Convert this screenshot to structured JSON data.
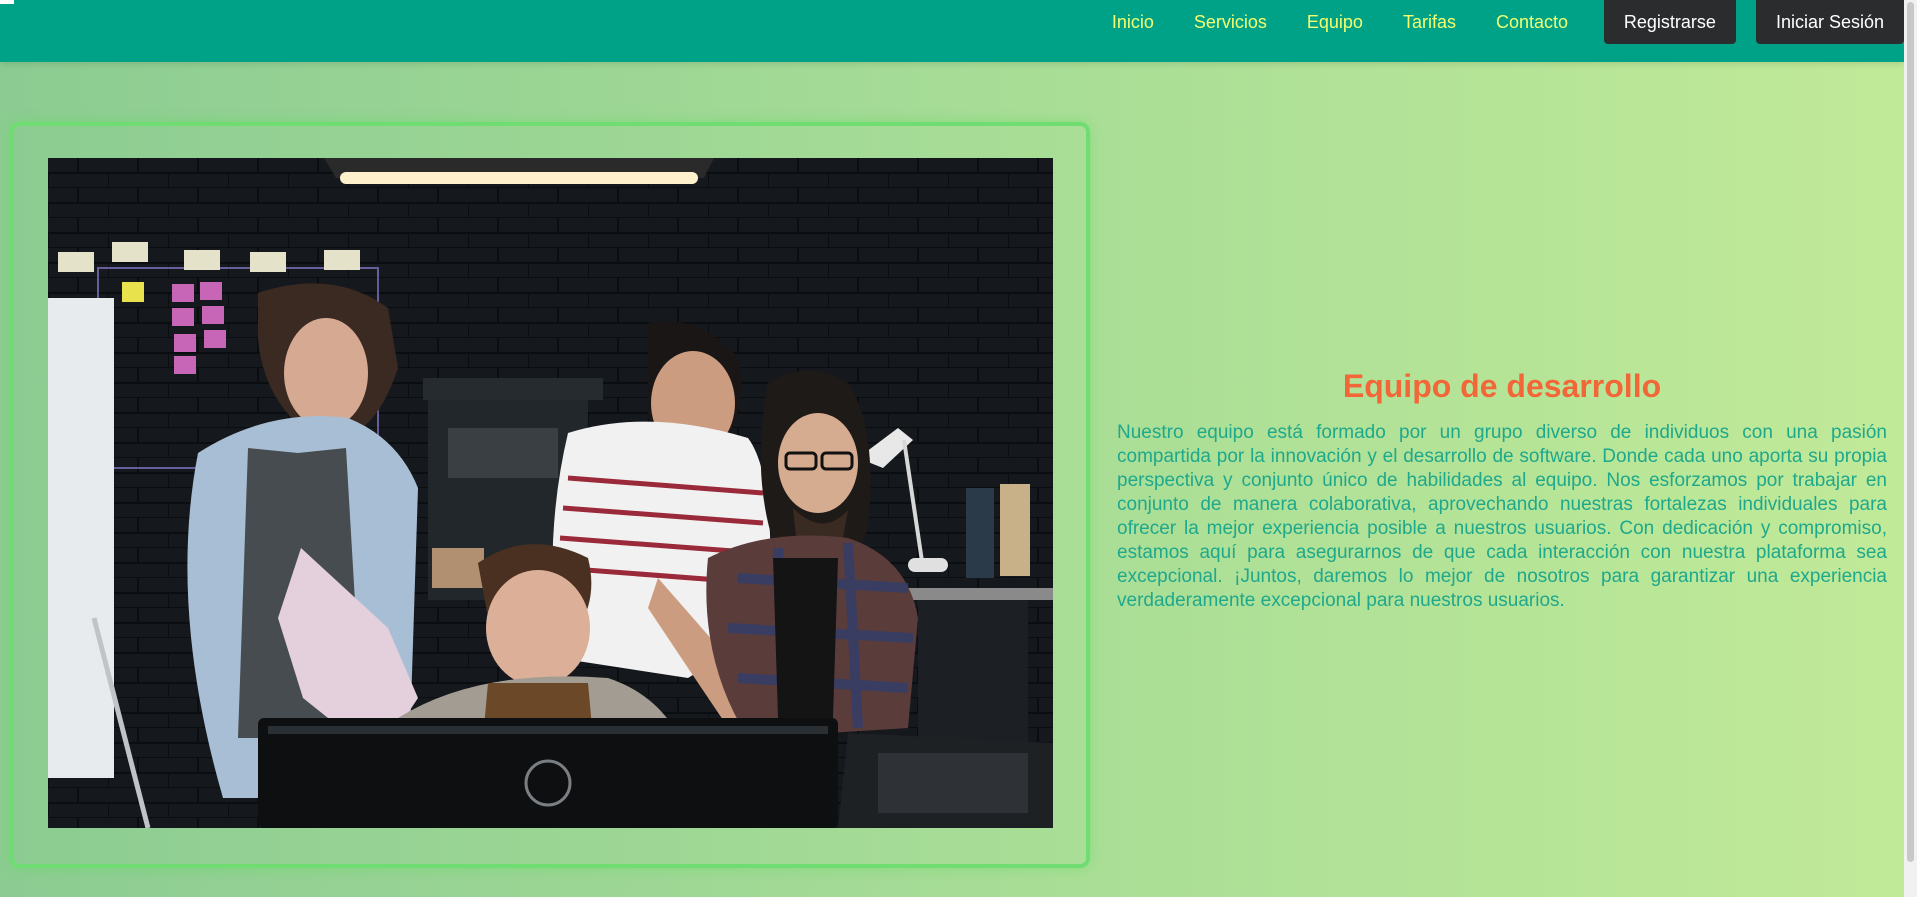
{
  "nav": {
    "links": [
      "Inicio",
      "Servicios",
      "Equipo",
      "Tarifas",
      "Contacto"
    ],
    "register_label": "Registrarse",
    "login_label": "Iniciar Sesión"
  },
  "section": {
    "title": "Equipo de desarrollo",
    "paragraph": "Nuestro equipo está formado por un grupo diverso de individuos con una pasión compartida por la innovación y el desarrollo de software. Donde cada uno aporta su propia perspectiva y conjunto único de habilidades al equipo. Nos esforzamos por trabajar en conjunto de manera colaborativa, aprovechando nuestras fortalezas individuales para ofrecer la mejor experiencia posible a nuestros usuarios. Con dedicación y compromiso, estamos aquí para asegurarnos de que cada interacción con nuestra plataforma sea excepcional. ¡Juntos, daremos lo mejor de nosotros para garantizar una experiencia verdaderamente excepcional para nuestros usuarios."
  },
  "colors": {
    "navbar": "#00a287",
    "nav_link": "#f3ff70",
    "button": "#2b2c2e",
    "title": "#f26638",
    "text": "#1ea88c",
    "frame_border": "#6fdd72"
  }
}
